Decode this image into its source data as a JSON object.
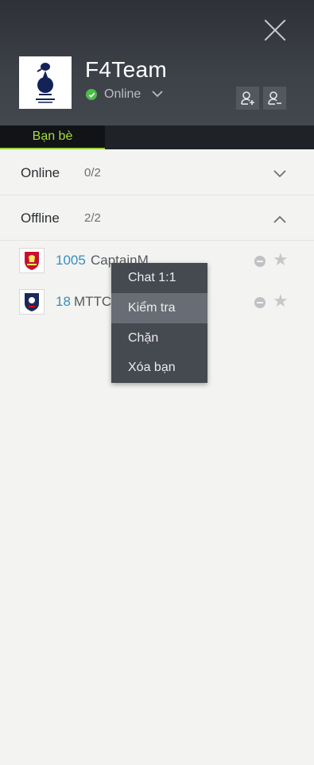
{
  "header": {
    "team_name": "F4Team",
    "status": "Online",
    "status_color": "#4cbb4a"
  },
  "tabs": [
    {
      "label": "Bạn bè",
      "active": true
    }
  ],
  "sections": {
    "online": {
      "label": "Online",
      "count": "0/2"
    },
    "offline": {
      "label": "Offline",
      "count": "2/2"
    }
  },
  "friends": [
    {
      "level": "1005",
      "name": "CaptainM",
      "club_icon": "liverpool-crest-icon"
    },
    {
      "level": "18",
      "name": "MTTC",
      "club_icon": "france-crest-icon"
    }
  ],
  "context_menu": {
    "items": [
      {
        "label": "Chat 1:1"
      },
      {
        "label": "Kiểm tra",
        "highlighted": true
      },
      {
        "label": "Chặn"
      },
      {
        "label": "Xóa bạn"
      }
    ]
  },
  "colors": {
    "accent": "#9bd13a",
    "level": "#3a8dc1",
    "header_bg": "#3d4148"
  }
}
